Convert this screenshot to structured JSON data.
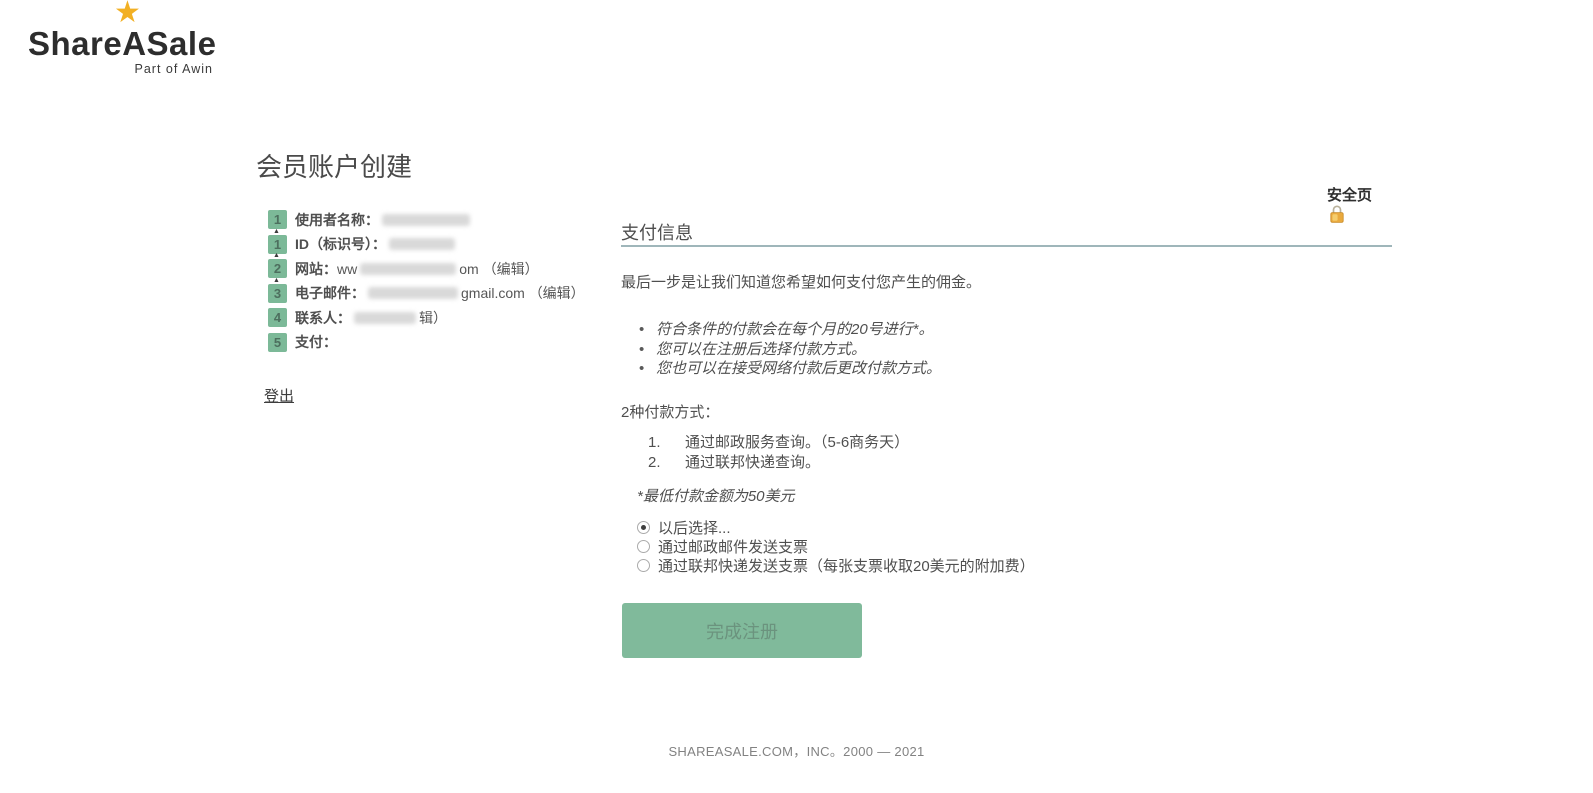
{
  "colors": {
    "accent_green": "#7CB998",
    "button_bg": "#80BA9B",
    "button_text": "#6B937E",
    "star_gold": "#F2B024",
    "lock_gold": "#E9A93D",
    "divider": "#9FB6BA"
  },
  "logo": {
    "brand": "ShareASale",
    "tagline": "Part of Awin",
    "star_icon": "star"
  },
  "page_title": "会员账户创建",
  "steps": [
    {
      "num": "1",
      "label": "使用者名称：",
      "pre": "",
      "post": "",
      "edit": ""
    },
    {
      "num": "1",
      "label": "ID（标识号）：",
      "pre": "",
      "post": "",
      "edit": ""
    },
    {
      "num": "2",
      "label": "网站：",
      "pre": "ww",
      "post": "om ",
      "edit": "（编辑）"
    },
    {
      "num": "3",
      "label": "电子邮件：",
      "pre": "",
      "post": "gmail.com ",
      "edit": "（编辑）"
    },
    {
      "num": "4",
      "label": "联系人：",
      "pre": "",
      "post": "",
      "edit": "辑）"
    },
    {
      "num": "5",
      "label": "支付：",
      "pre": "",
      "post": "",
      "edit": ""
    }
  ],
  "logout_label": "登出",
  "secure": {
    "label": "安全页",
    "lock_icon": "lock"
  },
  "payment": {
    "section_title": "支付信息",
    "intro": "最后一步是让我们知道您希望如何支付您产生的佣金。",
    "bullets": [
      "符合条件的付款会在每个月的20号进行*。",
      "您可以在注册后选择付款方式。",
      "您也可以在接受网络付款后更改付款方式。"
    ],
    "methods_heading": "2种付款方式：",
    "methods": [
      {
        "num": "1.",
        "text": "通过邮政服务查询。（5-6商务天）"
      },
      {
        "num": "2.",
        "text": "通过联邦快递查询。"
      }
    ],
    "note": "*最低付款金额为50美元",
    "options": [
      {
        "label": "以后选择...",
        "selected": true
      },
      {
        "label": "通过邮政邮件发送支票",
        "selected": false
      },
      {
        "label": "通过联邦快递发送支票（每张支票收取20美元的附加费）",
        "selected": false
      }
    ],
    "submit_label": "完成注册"
  },
  "footer": "SHAREASALE.COM，INC。2000 — 2021"
}
